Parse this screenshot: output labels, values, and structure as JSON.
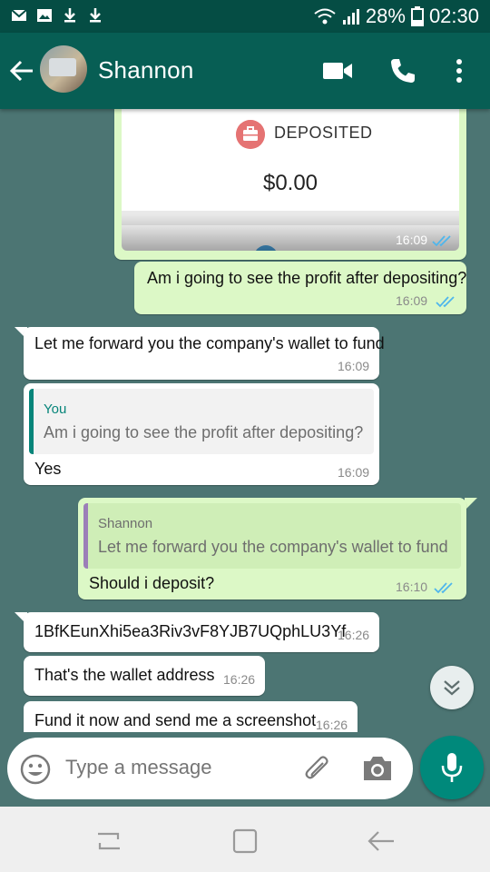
{
  "status_bar": {
    "battery": "28%",
    "time": "02:30"
  },
  "header": {
    "contact_name": "Shannon"
  },
  "card": {
    "label": "DEPOSITED",
    "amount": "$0.00",
    "time": "16:09"
  },
  "messages": [
    {
      "text": "Am i going to see the profit after depositing?",
      "time": "16:09"
    },
    {
      "text": "Let me forward you the company's wallet to fund",
      "time": "16:09"
    },
    {
      "quote_name": "You",
      "quote_text": "Am i going to see the profit after depositing?",
      "text": "Yes",
      "time": "16:09"
    },
    {
      "quote_name": "Shannon",
      "quote_text": "Let me forward you the company's wallet to fund",
      "text": "Should i deposit?",
      "time": "16:10"
    },
    {
      "text": "1BfKEunXhi5ea3Riv3vF8YJB7UQphLU3Yf",
      "time": "16:26"
    },
    {
      "text": "That's the wallet address",
      "time": "16:26"
    },
    {
      "text": "Fund it now and send me a screenshot",
      "time": "16:26"
    }
  ],
  "composer": {
    "placeholder": "Type a message"
  },
  "colors": {
    "header": "#075e54",
    "status_bar": "#054d44",
    "outgoing": "#dcf8c6",
    "incoming": "#ffffff",
    "tick_blue": "#4fb6ec",
    "mic": "#00897b"
  },
  "icons": {
    "status_left": [
      "gmail-icon",
      "gallery-icon",
      "download-icon",
      "download-icon"
    ],
    "status_right": [
      "wifi-icon",
      "signal-icon",
      "battery-icon"
    ],
    "header": [
      "back-arrow-icon",
      "video-call-icon",
      "phone-icon",
      "more-vert-icon"
    ],
    "composer": [
      "emoji-icon",
      "paperclip-icon",
      "camera-icon",
      "mic-icon"
    ],
    "nav": [
      "recent-apps-icon",
      "home-icon",
      "back-icon"
    ]
  }
}
